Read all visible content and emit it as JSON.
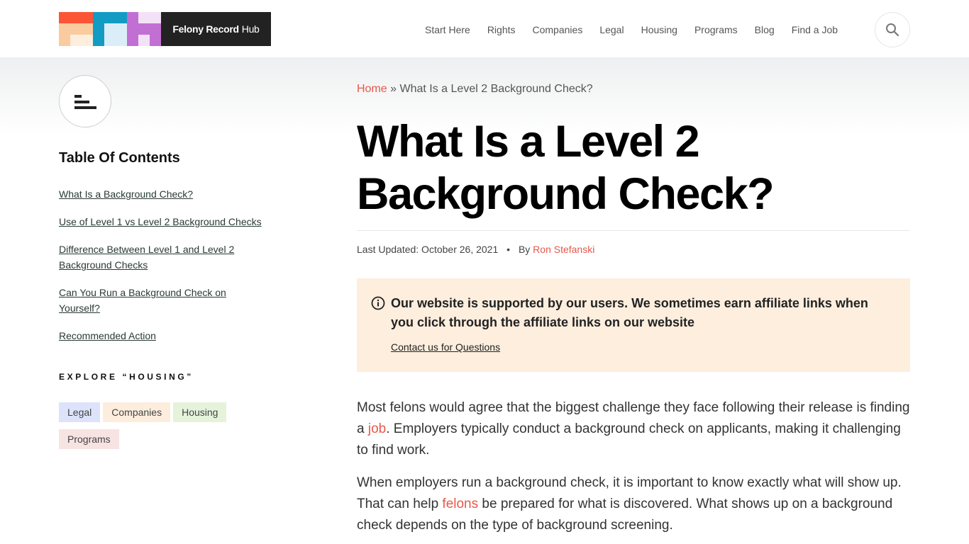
{
  "header": {
    "logo": {
      "bold": "Felony Record",
      "light": "Hub"
    },
    "nav": [
      "Start Here",
      "Rights",
      "Companies",
      "Legal",
      "Housing",
      "Programs",
      "Blog",
      "Find a Job"
    ],
    "search_icon": "search-icon"
  },
  "sidebar": {
    "toggle_icon": "toc-menu-icon",
    "toc_title": "Table Of Contents",
    "toc": [
      "What Is a Background Check?",
      "Use of Level 1 vs Level 2 Background Checks",
      "Difference Between Level 1 and Level 2 Background Checks",
      "Can You Run a Background Check on Yourself?",
      "Recommended Action"
    ],
    "explore_title": "EXPLORE “HOUSING”",
    "tags": [
      {
        "label": "Legal",
        "color": "#dde3fb"
      },
      {
        "label": "Companies",
        "color": "#fdeddd"
      },
      {
        "label": "Housing",
        "color": "#e5f3db"
      },
      {
        "label": "Programs",
        "color": "#f8e3e3"
      }
    ]
  },
  "main": {
    "breadcrumb": {
      "home": "Home",
      "sep": "»",
      "current": "What Is a Level 2 Background Check?"
    },
    "title": "What Is a Level 2 Background Check?",
    "meta": {
      "updated": "Last Updated: October 26, 2021",
      "dot": "•",
      "by": "By",
      "author": "Ron Stefanski"
    },
    "notice": {
      "icon": "info-icon",
      "text": "Our website is supported by our users. We sometimes earn affiliate links when you click through the affiliate links on our website",
      "link": "Contact us for Questions"
    },
    "paragraphs": [
      {
        "before": "Most felons would agree that the biggest challenge they face following their release is finding a ",
        "link": "job",
        "after": ". Employers typically conduct a background check on applicants, making it challenging to find work."
      },
      {
        "before": "When employers run a background check, it is important to know exactly what will show up. That can help ",
        "link": "felons",
        "after": " be prepared for what is discovered. What shows up on a background check depends on the type of background screening."
      }
    ]
  },
  "colors": {
    "accent": "#e6584a",
    "notice_bg": "#fdeede",
    "logo_dark": "#222222"
  }
}
